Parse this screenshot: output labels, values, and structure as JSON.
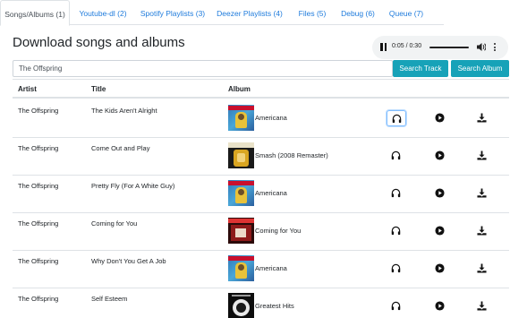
{
  "tabs": [
    {
      "label": "Songs/Albums (1)",
      "active": true
    },
    {
      "label": "Youtube-dl (2)",
      "active": false
    },
    {
      "label": "Spotify Playlists (3)",
      "active": false
    },
    {
      "label": "Deezer Playlists (4)",
      "active": false
    },
    {
      "label": "Files (5)",
      "active": false
    },
    {
      "label": "Debug (6)",
      "active": false
    },
    {
      "label": "Queue (7)",
      "active": false
    }
  ],
  "page_title": "Download songs and albums",
  "player": {
    "time": "0:05 / 0:30"
  },
  "search": {
    "value": "The Offspring"
  },
  "buttons": {
    "search_track": "Search Track",
    "search_album": "Search Album"
  },
  "table": {
    "headers": {
      "artist": "Artist",
      "title": "Title",
      "album": "Album"
    },
    "rows": [
      {
        "artist": "The Offspring",
        "title": "The Kids Aren't Alright",
        "album": "Americana",
        "cover": "americana-cover"
      },
      {
        "artist": "The Offspring",
        "title": "Come Out and Play",
        "album": "Smash (2008 Remaster)",
        "cover": "smash-cover"
      },
      {
        "artist": "The Offspring",
        "title": "Pretty Fly (For A White Guy)",
        "album": "Americana",
        "cover": "americana-cover"
      },
      {
        "artist": "The Offspring",
        "title": "Coming for You",
        "album": "Coming for You",
        "cover": "coming-for-you-cover"
      },
      {
        "artist": "The Offspring",
        "title": "Why Don't You Get A Job",
        "album": "Americana",
        "cover": "americana-cover"
      },
      {
        "artist": "The Offspring",
        "title": "Self Esteem",
        "album": "Greatest Hits",
        "cover": "greatest-hits-cover"
      }
    ]
  },
  "colors": {
    "link": "#1e7bdc",
    "accent": "#17a2b8",
    "border": "#dee2e6",
    "text": "#212529"
  },
  "icons": {
    "listen": "headphones-icon",
    "play": "play-circle-icon",
    "download": "download-icon",
    "pause": "pause-icon",
    "volume": "volume-icon",
    "more": "more-vertical-icon"
  }
}
